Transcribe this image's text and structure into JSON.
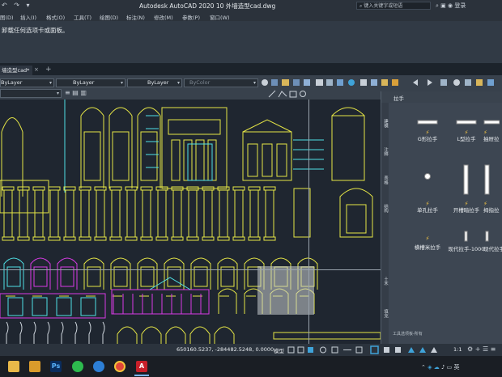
{
  "titlebar": {
    "app_title": "Autodesk AutoCAD 2020    10 外墙造型cad.dwg",
    "search_placeholder": "键入关键字或短语",
    "login_label": "登录"
  },
  "menu": {
    "items": [
      "图(D)",
      "插入(I)",
      "格式(O)",
      "工具(T)",
      "绘图(D)",
      "标注(N)",
      "修改(M)",
      "参数(P)",
      "窗口(W)"
    ]
  },
  "ribbon": {
    "message": "卸载任何选项卡或面板。"
  },
  "tabs": {
    "active_label": "墙造型cad*",
    "close_glyph": "×",
    "add_glyph": "+"
  },
  "toolbar": {
    "layer_combo": "ByLayer",
    "linetype_combo": "ByLayer",
    "lineweight_combo": "ByLayer",
    "color_combo": "ByColor"
  },
  "palette": {
    "title": "拉手",
    "side_tabs": [
      "建模",
      "注释",
      "表格",
      "结构",
      "土木",
      "填充"
    ],
    "items": [
      {
        "label": "G形拉手",
        "icon": "g-handle-icon"
      },
      {
        "label": "L型拉手",
        "icon": "l-handle-icon"
      },
      {
        "label": "抽屉拉",
        "icon": "drawer-handle-icon"
      },
      {
        "label": "单孔拉手",
        "icon": "single-hole-handle-icon"
      },
      {
        "label": "开槽暗拉手",
        "icon": "slot-handle-icon"
      },
      {
        "label": "拇指拉",
        "icon": "thumb-handle-icon"
      },
      {
        "label": "横槽米拉手",
        "icon": "horizontal-slot-handle-icon"
      },
      {
        "label": "现代拉手-1000",
        "icon": "modern-handle-1000-icon"
      },
      {
        "label": "现代拉手-12",
        "icon": "modern-handle-12-icon"
      }
    ],
    "footer_label": "工具选项板-所有"
  },
  "statusbar": {
    "coordinates": "650160.5237, -284482.5248, 0.0000",
    "model_label": "模型",
    "scale_label": "1:1"
  },
  "taskbar": {
    "apps": [
      "file-explorer-icon",
      "folder-icon",
      "photoshop-icon",
      "wechat-icon",
      "edge-icon",
      "chrome-icon",
      "autocad-icon"
    ],
    "ps_label": "Ps",
    "cad_label": "A"
  },
  "colors": {
    "drawing_yellow": "#e6e646",
    "drawing_magenta": "#d93be6",
    "drawing_cyan": "#4fe0e6",
    "canvas_bg": "#1f2630"
  }
}
